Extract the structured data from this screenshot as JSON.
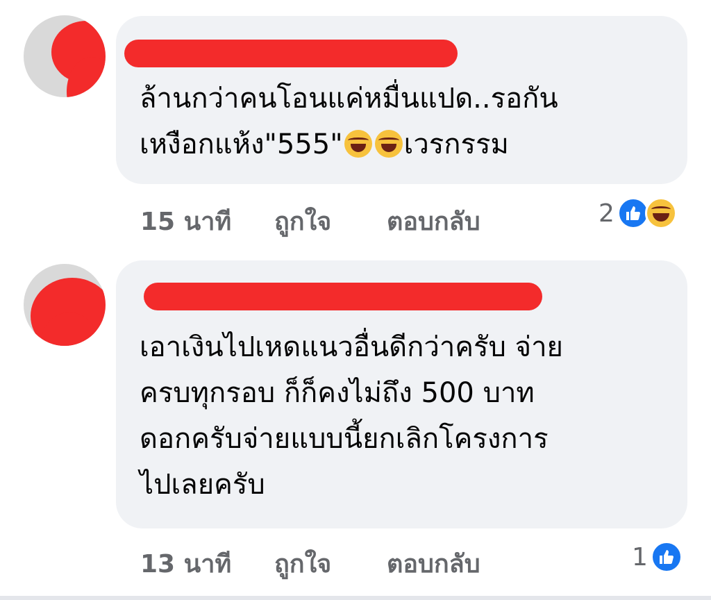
{
  "comments": [
    {
      "text": "ล้านกว่าคนโอนแค่หมื่นแปด..รอกัน\nเหงือกแห้ง\"555\"",
      "text_suffix": "เวรกรรม",
      "emojis": [
        "tears-of-joy-emoji",
        "tears-of-joy-emoji"
      ],
      "time": "15 นาที",
      "like_label": "ถูกใจ",
      "reply_label": "ตอบกลับ",
      "reaction_count": "2",
      "reaction_icons": [
        "like-icon",
        "haha-icon"
      ]
    },
    {
      "text": "เอาเงินไปเหดแนวอื่นดีกว่าครับ จ่าย\nครบทุกรอบ ก็ก็คงไม่ถึง 500 บาท\nดอกครับจ่ายแบบนี้ยกเลิกโครงการ\nไปเลยครับ",
      "time": "13 นาที",
      "like_label": "ถูกใจ",
      "reply_label": "ตอบกลับ",
      "reaction_count": "1",
      "reaction_icons": [
        "like-icon"
      ]
    }
  ],
  "colors": {
    "bubble": "#f0f2f5",
    "redaction": "#f32b2b",
    "meta_text": "#65676b",
    "like_blue": "#1877f2"
  }
}
